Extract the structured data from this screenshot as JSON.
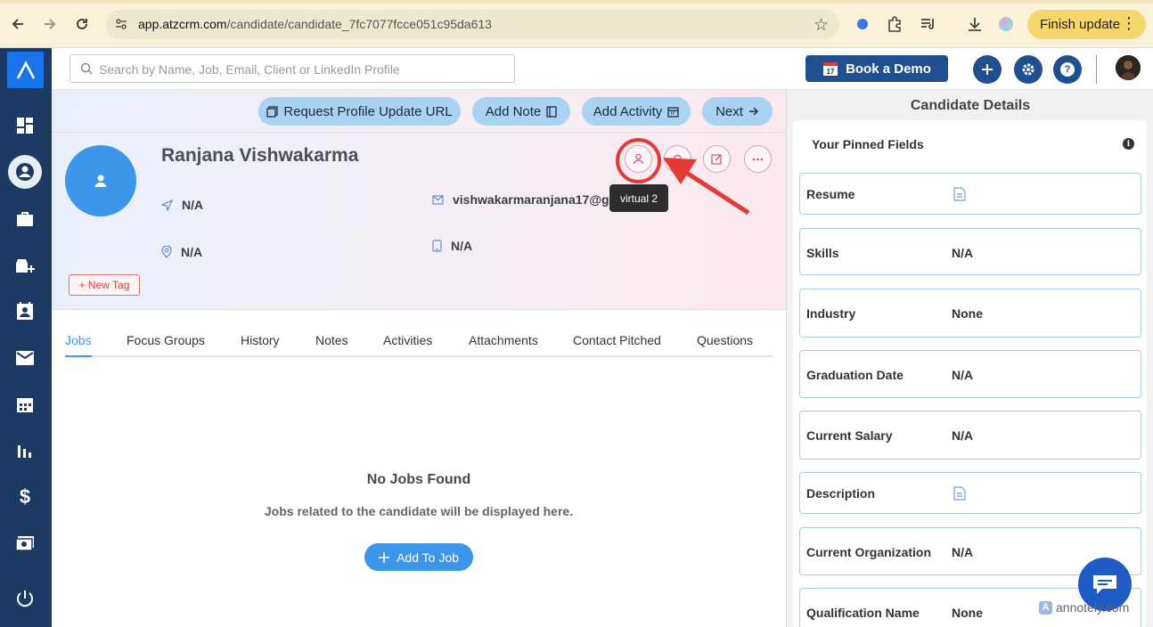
{
  "browser": {
    "url_host": "app.atzcrm.com",
    "url_path": "/candidate/candidate_7fc7077fcce051c95da613",
    "update_label": "Finish update"
  },
  "header": {
    "search_placeholder": "Search by Name, Job, Email, Client or LinkedIn Profile",
    "demo_label": "Book a Demo",
    "help_label": "?"
  },
  "actions": {
    "request_profile": "Request Profile Update URL",
    "add_note": "Add Note",
    "add_activity": "Add Activity",
    "next": "Next"
  },
  "candidate": {
    "name": "Ranjana Vishwakarma",
    "position": "N/A",
    "location": "N/A",
    "email": "vishwakarmaranjana17@gm",
    "phone": "N/A",
    "new_tag": "+ New Tag",
    "tooltip": "virtual 2"
  },
  "tabs": [
    "Jobs",
    "Focus Groups",
    "History",
    "Notes",
    "Activities",
    "Attachments",
    "Contact Pitched",
    "Questions"
  ],
  "empty_state": {
    "title": "No Jobs Found",
    "subtitle": "Jobs related to the candidate will be displayed here.",
    "button": "Add To Job"
  },
  "details": {
    "title": "Candidate Details",
    "pinned_title": "Your Pinned Fields",
    "info_glyph": "i",
    "fields": [
      {
        "label": "Resume",
        "value": null,
        "icon": "document-icon"
      },
      {
        "label": "Skills",
        "value": "N/A"
      },
      {
        "label": "Industry",
        "value": "None"
      },
      {
        "label": "Graduation Date",
        "value": "N/A"
      },
      {
        "label": "Current Salary",
        "value": "N/A"
      },
      {
        "label": "Description",
        "value": null,
        "icon": "document-icon"
      },
      {
        "label": "Current Organization",
        "value": "N/A"
      },
      {
        "label": "Qualification Name",
        "value": "None"
      }
    ]
  },
  "watermark": {
    "text": "annotely.com",
    "glyph": "A"
  },
  "colors": {
    "sidebar": "#1c3a63",
    "primary": "#3d96ea",
    "pill": "#a9d2f3",
    "highlight": "#e53935",
    "brand_button": "#1f4f8f"
  }
}
